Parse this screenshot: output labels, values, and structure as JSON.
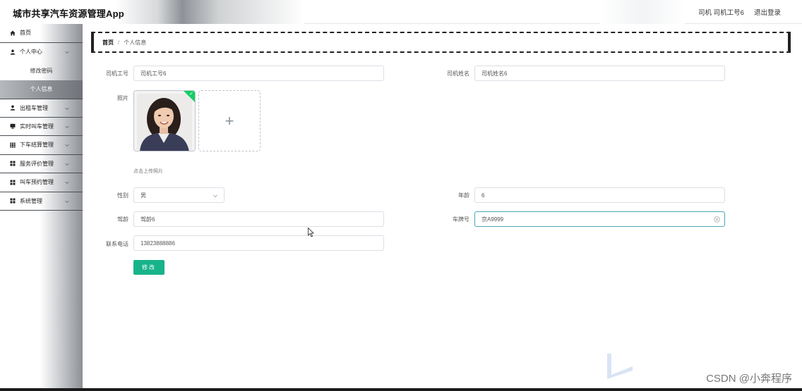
{
  "header": {
    "app_title": "城市共享汽车资源管理App",
    "user_info": "司机 司机工号6",
    "logout": "退出登录"
  },
  "sidebar": {
    "items": [
      {
        "label": "首页",
        "icon": "home-icon"
      },
      {
        "label": "个人中心",
        "icon": "user-icon"
      },
      {
        "label": "修改密码"
      },
      {
        "label": "个人信息"
      },
      {
        "label": "出租车管理",
        "icon": "user-icon"
      },
      {
        "label": "实时叫车管理",
        "icon": "monitor-icon"
      },
      {
        "label": "下车结算管理",
        "icon": "grid-icon"
      },
      {
        "label": "服务评价管理",
        "icon": "grid-icon"
      },
      {
        "label": "叫车预约管理",
        "icon": "grid-icon"
      },
      {
        "label": "系统管理",
        "icon": "grid-icon"
      }
    ]
  },
  "breadcrumb": {
    "home": "首页",
    "separator": "/",
    "current": "个人信息"
  },
  "form": {
    "driver_id_label": "司机工号",
    "driver_id_value": "司机工号6",
    "driver_name_label": "司机姓名",
    "driver_name_value": "司机姓名6",
    "photo_label": "照片",
    "upload_plus": "+",
    "upload_tip": "点击上传照片",
    "gender_label": "性别",
    "gender_value": "男",
    "age_label": "年龄",
    "age_value": "6",
    "driving_years_label": "驾龄",
    "driving_years_value": "驾龄6",
    "plate_label": "车牌号",
    "plate_value": "京A9999",
    "phone_label": "联系电话",
    "phone_value": "13823888886",
    "submit_label": "修改"
  },
  "watermark": "CSDN @小奔程序",
  "colors": {
    "accent": "#17b38a",
    "success_badge": "#13ce66",
    "focus_border": "#4aa6b8"
  }
}
